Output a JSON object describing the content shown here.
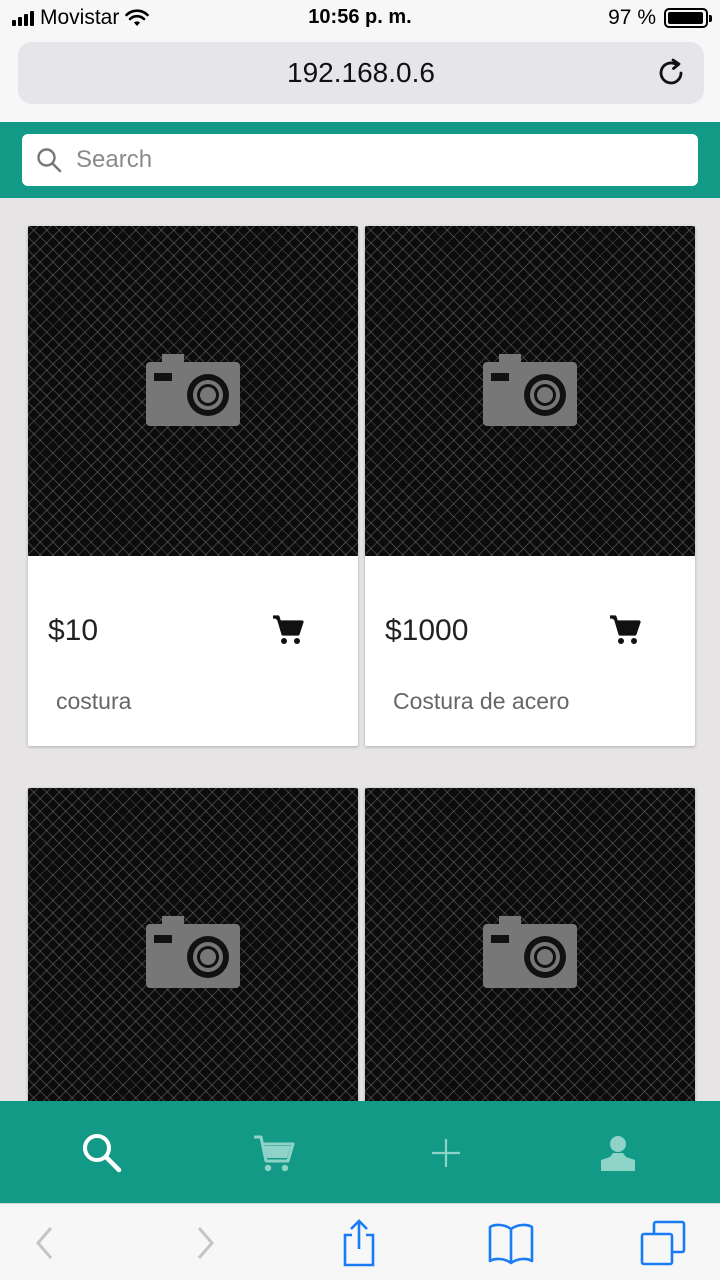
{
  "status": {
    "carrier": "Movistar",
    "time": "10:56 p. m.",
    "battery": "97 %",
    "battery_level": 0.97
  },
  "browser": {
    "url": "192.168.0.6"
  },
  "search": {
    "placeholder": "Search"
  },
  "products": [
    {
      "price": "$10",
      "name": "costura"
    },
    {
      "price": "$1000",
      "name": "Costura de acero"
    },
    {
      "price": "",
      "name": ""
    },
    {
      "price": "",
      "name": ""
    }
  ],
  "tabs": [
    {
      "icon": "search-icon",
      "active": true
    },
    {
      "icon": "cart-icon",
      "active": false
    },
    {
      "icon": "plus-icon",
      "active": false
    },
    {
      "icon": "user-icon",
      "active": false
    }
  ],
  "colors": {
    "accent": "#139a86",
    "background": "#e6e4e5",
    "ios_blue": "#1a7cf5"
  }
}
